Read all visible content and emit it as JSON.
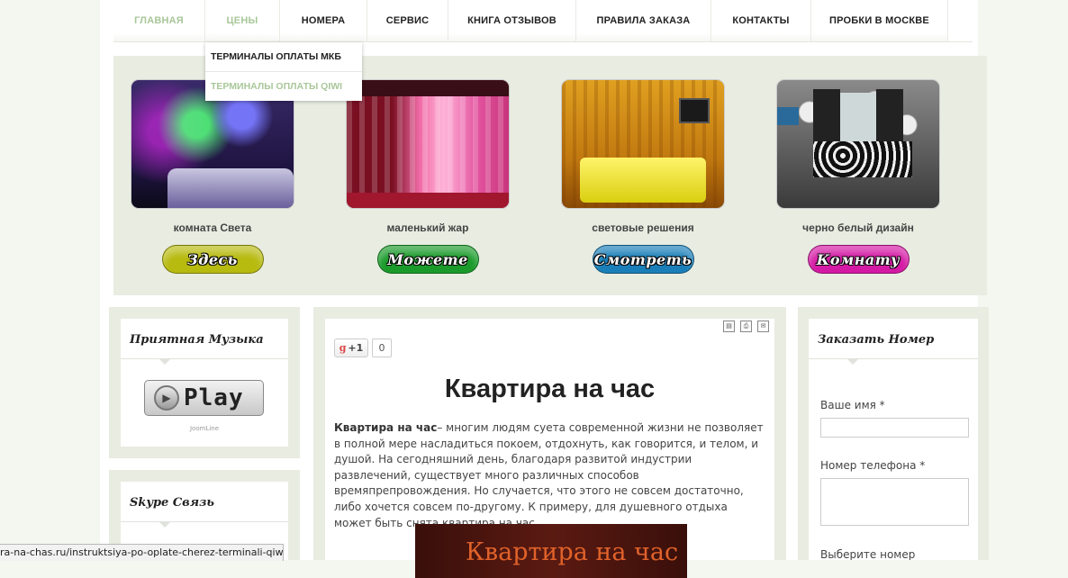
{
  "nav": {
    "items": [
      {
        "label": "ГЛАВНАЯ",
        "dim": true
      },
      {
        "label": "ЦЕНЫ",
        "dim": true
      },
      {
        "label": "НОМЕРА",
        "dim": false
      },
      {
        "label": "СЕРВИС",
        "dim": false
      },
      {
        "label": "КНИГА ОТЗЫВОВ",
        "dim": false
      },
      {
        "label": "ПРАВИЛА ЗАКАЗА",
        "dim": false
      },
      {
        "label": "КОНТАКТЫ",
        "dim": false
      },
      {
        "label": "ПРОБКИ В МОСКВЕ",
        "dim": false
      }
    ],
    "dropdown": [
      "ТЕРМИНАЛЫ ОПЛАТЫ МКБ",
      "ТЕРМИНАЛЫ ОПЛАТЫ QIWI"
    ]
  },
  "rooms": [
    {
      "caption": "комната Света",
      "button": "Здесь",
      "color": "#b7ba0f"
    },
    {
      "caption": "маленький жар",
      "button": "Можете",
      "color": "#1a9a2a"
    },
    {
      "caption": "световые решения",
      "button": "Смотреть",
      "color": "#1a7fb8"
    },
    {
      "caption": "черно белый дизайн",
      "button": "Комнату",
      "color": "#d41aa4"
    }
  ],
  "music": {
    "title": "Приятная Музыка",
    "play": "Play",
    "credit": "JoomLine"
  },
  "skype": {
    "title": "Skype Связь"
  },
  "article": {
    "gplus_label": "+1",
    "gplus_count": "0",
    "title": "Квартира на час",
    "lead": "Квартира на час",
    "body": "– многим людям суета современной жизни не позволяет в полной мере насладиться покоем, отдохнуть, как говорится, и телом, и душой. На сегодняшний день, благодаря развитой индустрии развлечений, существует много различных способов времяпрепровождения. Но случается, что этого не совсем достаточно, либо хочется совсем по-другому. К примеру, для душевного отдыха может быть снята квартира на час.",
    "image_text": "Квартира на час"
  },
  "order": {
    "title": "Заказать Номер",
    "name_label": "Ваше имя *",
    "phone_label": "Номер телефона *",
    "room_label": "Выберите номер"
  },
  "status_url": "ra-na-chas.ru/instruktsiya-po-oplate-cherez-terminali-qiwi"
}
